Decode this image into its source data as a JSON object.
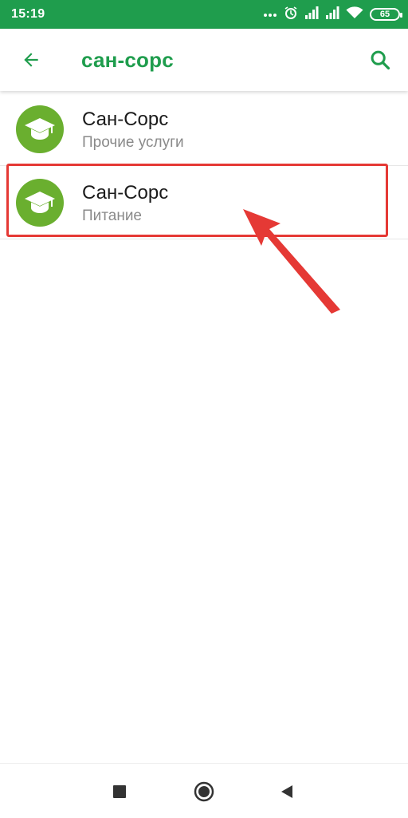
{
  "status_bar": {
    "time": "15:19",
    "battery": "65",
    "background": "#1f9d4d",
    "icons": [
      "more-dots-icon",
      "alarm-icon",
      "signal-icon",
      "signal-icon",
      "wifi-icon",
      "battery-icon"
    ]
  },
  "toolbar": {
    "title": "сан-сорс",
    "back_icon": "arrow-left-icon",
    "search_icon": "search-icon",
    "accent": "#1f9d4d"
  },
  "results": [
    {
      "title": "Сан-Сорс",
      "subtitle": "Прочие услуги",
      "icon": "graduation-cap-icon",
      "icon_bg": "#6aaf2f"
    },
    {
      "title": "Сан-Сорс",
      "subtitle": "Питание",
      "icon": "graduation-cap-icon",
      "icon_bg": "#6aaf2f",
      "highlighted": true
    }
  ],
  "annotation": {
    "color": "#e53935"
  },
  "nav_bar": {
    "buttons": [
      "recents-square-icon",
      "home-circle-icon",
      "back-triangle-icon"
    ]
  }
}
